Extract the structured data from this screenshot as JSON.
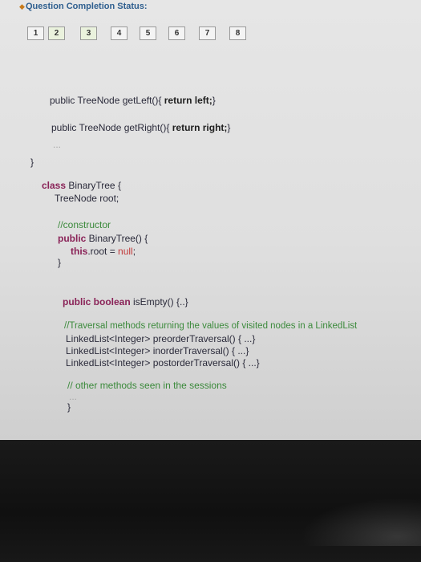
{
  "status": {
    "title": "Question Completion Status:",
    "questions": [
      {
        "label": "1",
        "answered": false
      },
      {
        "label": "2",
        "answered": true
      },
      {
        "label": "3",
        "answered": true
      },
      {
        "label": "4",
        "answered": false
      },
      {
        "label": "5",
        "answered": false
      },
      {
        "label": "6",
        "answered": false
      },
      {
        "label": "7",
        "answered": false
      },
      {
        "label": "8",
        "answered": false
      }
    ]
  },
  "code": {
    "getleft": {
      "sig": "public TreeNode getLeft(){ ",
      "ret": "return left;",
      "close": "}"
    },
    "getright": {
      "sig": "public TreeNode getRight(){ ",
      "ret": "return right;",
      "close": "}"
    },
    "ellipsis1": "...",
    "node_close": "}",
    "class_decl": {
      "kw": "class",
      "rest": " BinaryTree {"
    },
    "root_decl": "TreeNode root;",
    "ctor_comment": "//constructor",
    "ctor_sig": {
      "kw": "public",
      "rest": " BinaryTree() {"
    },
    "ctor_body": {
      "this": "this",
      "mid": ".root = ",
      "null": "null",
      "end": ";"
    },
    "ctor_close": "}",
    "isempty": {
      "kw": "public boolean",
      "rest": " isEmpty() {..}"
    },
    "traversal_comment": "//Traversal methods returning the values of visited nodes in a LinkedList",
    "preorder": "LinkedList<Integer> preorderTraversal() { ...}",
    "inorder": "LinkedList<Integer> inorderTraversal() { ...}",
    "postorder": "LinkedList<Integer> postorderTraversal() { ...}",
    "other_comment": "// other methods seen in the sessions",
    "ellipsis2": "...",
    "class_close": "}"
  }
}
